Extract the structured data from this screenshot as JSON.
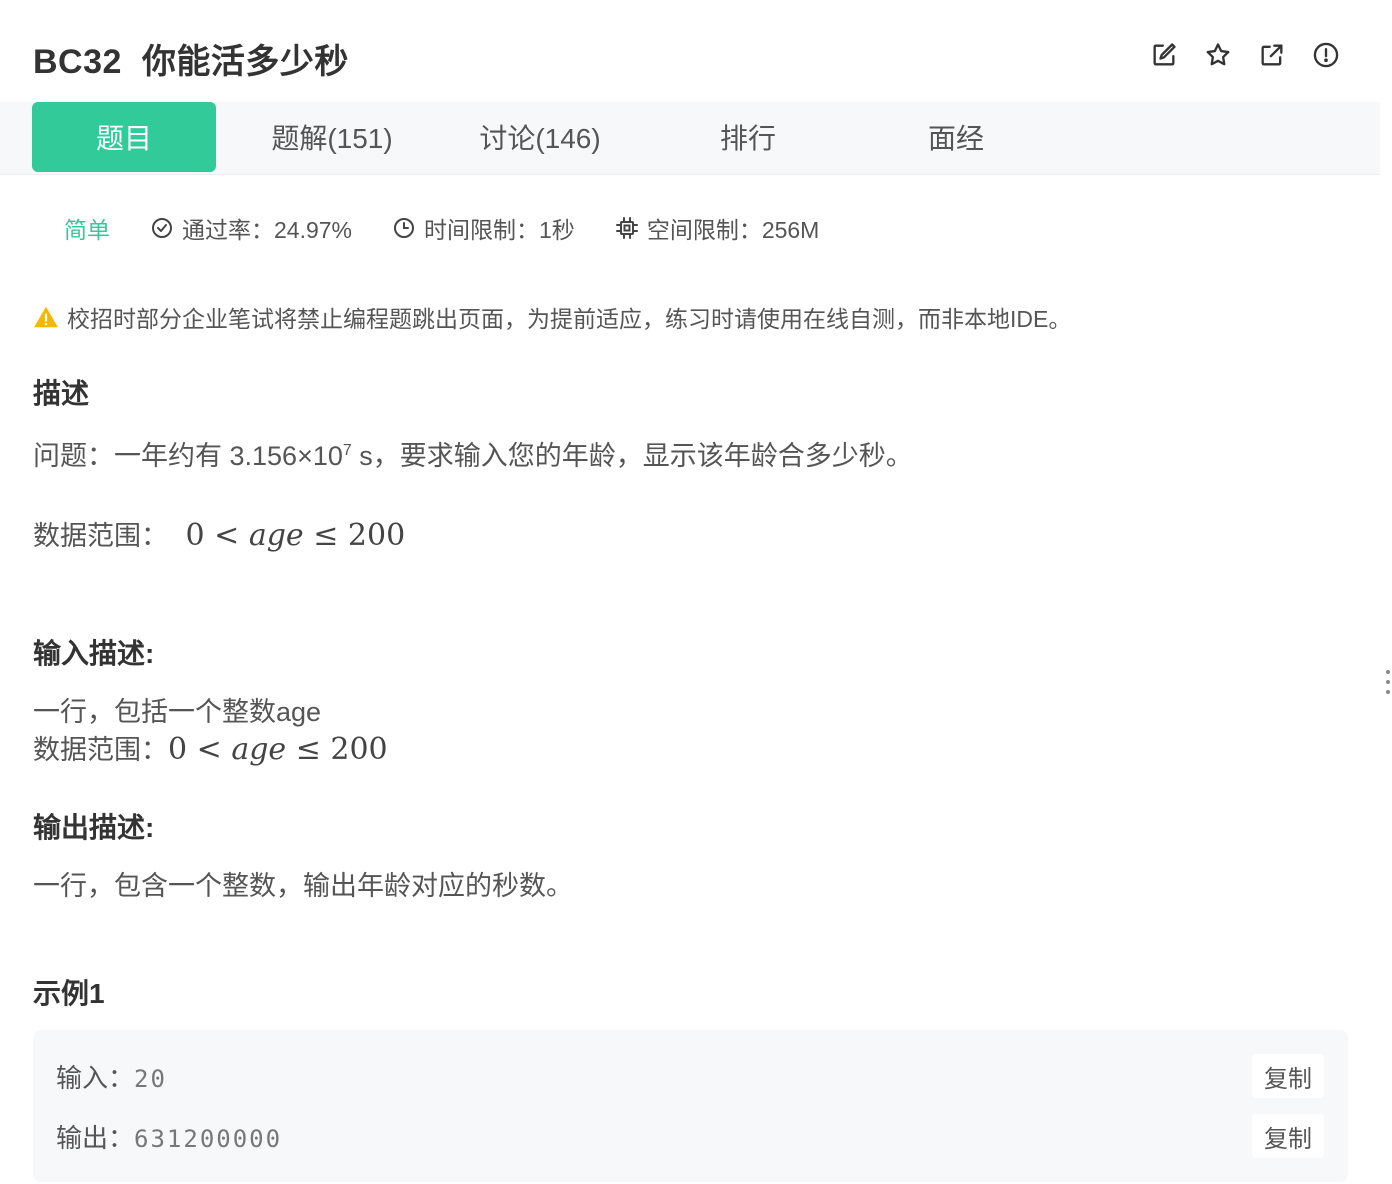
{
  "header": {
    "problem_code": "BC32",
    "problem_title": "你能活多少秒",
    "icons": [
      "edit-icon",
      "star-icon",
      "share-icon",
      "report-icon"
    ]
  },
  "tabs": [
    {
      "label": "题目",
      "active": true
    },
    {
      "label": "题解(151)",
      "active": false
    },
    {
      "label": "讨论(146)",
      "active": false
    },
    {
      "label": "排行",
      "active": false
    },
    {
      "label": "面经",
      "active": false
    }
  ],
  "meta": {
    "difficulty": "简单",
    "pass_rate": "通过率：24.97%",
    "time_limit": "时间限制：1秒",
    "memory_limit": "空间限制：256M"
  },
  "warning": "校招时部分企业笔试将禁止编程题跳出页面，为提前适应，练习时请使用在线自测，而非本地IDE。",
  "description": {
    "title": "描述",
    "question_prefix": "问题：一年约有 3.156×10",
    "question_exp": "7",
    "question_suffix": " s，要求输入您的年龄，显示该年龄合多少秒。",
    "range_label": "数据范围：",
    "range_left": "0 <",
    "range_var": "age",
    "range_right": "≤ 200"
  },
  "input_desc": {
    "title": "输入描述:",
    "line1": "一行，包括一个整数age",
    "range_label": "数据范围：",
    "range_left": "0 <",
    "range_var": "age",
    "range_right": "≤ 200"
  },
  "output_desc": {
    "title": "输出描述:",
    "line1": "一行，包含一个整数，输出年龄对应的秒数。"
  },
  "example": {
    "title": "示例1",
    "input_label": "输入：",
    "input_value": "20",
    "output_label": "输出：",
    "output_value": "631200000",
    "copy_label": "复制"
  },
  "colors": {
    "accent": "#32ca99",
    "warning": "#f5b800"
  }
}
